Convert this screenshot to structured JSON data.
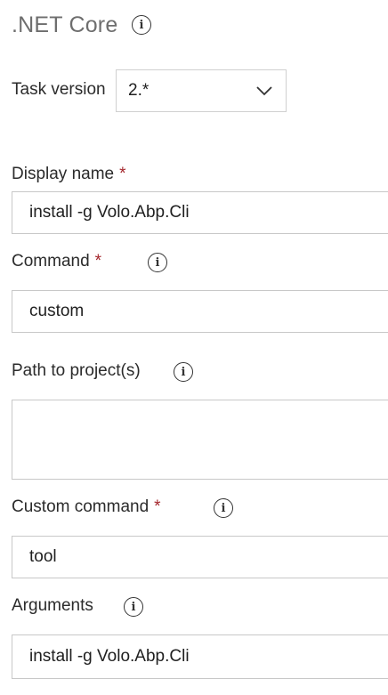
{
  "task": {
    "title": ".NET Core",
    "version_label": "Task version",
    "version_value": "2.*"
  },
  "required_mark": "*",
  "fields": {
    "display_name": {
      "label": "Display name",
      "value": "install -g Volo.Abp.Cli"
    },
    "command": {
      "label": "Command",
      "value": "custom"
    },
    "path_to_projects": {
      "label": "Path to project(s)",
      "value": ""
    },
    "custom_command": {
      "label": "Custom command",
      "value": "tool"
    },
    "arguments": {
      "label": "Arguments",
      "value": "install -g Volo.Abp.Cli"
    }
  },
  "icons": {
    "info": "info-icon",
    "dropdown": "chevron-down-icon"
  }
}
